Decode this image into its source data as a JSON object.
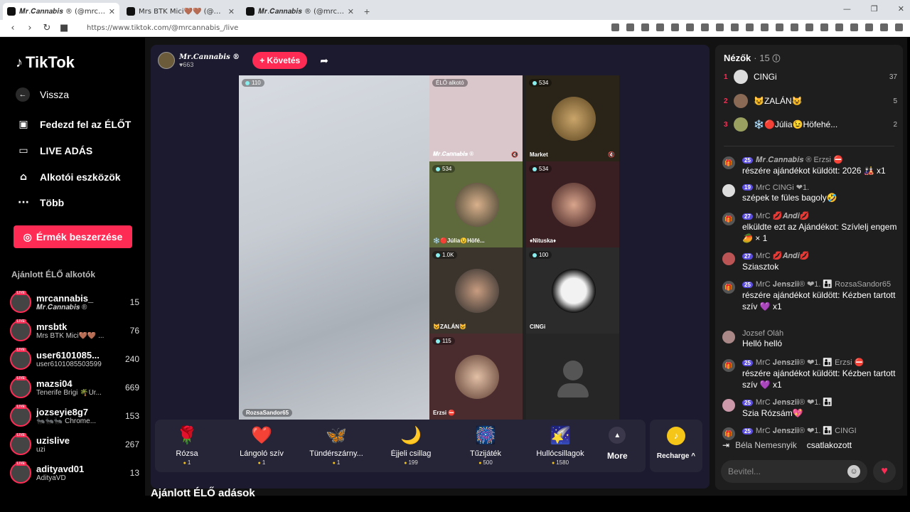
{
  "browser": {
    "tabs": [
      {
        "title": "𝑴𝒓.𝑪𝒂𝒏𝒏𝒂𝒃𝒊𝒔 ® (@mrcan",
        "active": true
      },
      {
        "title": "Mrs BTK Mici🤎🤎 (@mrsb",
        "active": false
      },
      {
        "title": "𝑴𝒓.𝑪𝒂𝒏𝒏𝒂𝒃𝒊𝒔 ® (@mrcannabis_)",
        "active": false
      }
    ],
    "url": "https://www.tiktok.com/@mrcannabis_/live"
  },
  "sidebar": {
    "logo": "TikTok",
    "back": "Vissza",
    "nav": [
      {
        "label": "Fedezd fel az ÉLŐT",
        "icon": "tv-icon"
      },
      {
        "label": "LIVE ADÁS",
        "icon": "camera-icon"
      },
      {
        "label": "Alkotói eszközök",
        "icon": "creator-tools-icon"
      },
      {
        "label": "Több",
        "icon": "more-icon"
      }
    ],
    "coins_button": "Érmék beszerzése",
    "recommended_title": "Ajánlott ÉLŐ alkotók",
    "creators": [
      {
        "name": "mrcannabis_",
        "sub": "𝑴𝒓.𝑪𝒂𝒏𝒏𝒂𝒃𝒊𝒔 ®",
        "count": "15"
      },
      {
        "name": "mrsbtk",
        "sub": "Mrs BTK Mici🤎🤎 ...",
        "count": "76"
      },
      {
        "name": "user6101085...",
        "sub": "user6101085503599",
        "count": "240"
      },
      {
        "name": "mazsi04",
        "sub": "Tenerife Brigi 🌴Úr...",
        "count": "669"
      },
      {
        "name": "jozseyie8g7",
        "sub": "🐜🐜🐜 Chrome...",
        "count": "153"
      },
      {
        "name": "uzislive",
        "sub": "uzi",
        "count": "267"
      },
      {
        "name": "adityavd01",
        "sub": "AdityaVD",
        "count": "13"
      }
    ]
  },
  "host": {
    "name": "𝑴𝒓.𝑪𝒂𝒏𝒏𝒂𝒃𝒊𝒔 ®",
    "likes": "♥663",
    "follow_label": "+ Követés"
  },
  "stage": {
    "main": {
      "badge": "110",
      "name": "RozsaSandor65"
    },
    "cells": [
      {
        "badge": "ÉLŐ alkotó",
        "name": "𝑴𝒓.𝑪𝒂𝒏𝒏𝒂𝒃𝒊𝒔 ®",
        "color": "#d9c7cc"
      },
      {
        "badge": "534",
        "name": "Market",
        "color": "#2a2418"
      },
      {
        "badge": "534",
        "name": "❄️🔴Júlia😉Höfé...",
        "color": "#5f6a3c"
      },
      {
        "badge": "534",
        "name": "♦Nituska♦",
        "color": "#3a1f22"
      },
      {
        "badge": "1.0K",
        "name": "😺ZALÁN😺",
        "color": "#3a342c"
      },
      {
        "badge": "100",
        "name": "CINGi",
        "color": "#2b2b2b"
      },
      {
        "badge": "115",
        "name": "Erzsi ⛔",
        "color": "#4a2c2e"
      },
      {
        "badge": "",
        "name": "",
        "color": "#262626"
      }
    ]
  },
  "gifts": [
    {
      "name": "Rózsa",
      "price": "1",
      "icon": "🌹"
    },
    {
      "name": "Lángoló szív",
      "price": "1",
      "icon": "❤️"
    },
    {
      "name": "Tündérszárny...",
      "price": "1",
      "icon": "🦋"
    },
    {
      "name": "Éjjeli csillag",
      "price": "199",
      "icon": "🌙"
    },
    {
      "name": "Tűzijáték",
      "price": "500",
      "icon": "🎆"
    },
    {
      "name": "Hullócsillagok",
      "price": "1580",
      "icon": "🌠"
    }
  ],
  "more_label": "More",
  "recharge_label": "Recharge ^",
  "recommended_lives": "Ajánlott ÉLŐ adások",
  "chat": {
    "viewers_title": "Nézők",
    "viewers_count": "· 15",
    "top_viewers": [
      {
        "rank": "1",
        "name": "CINGi",
        "score": "37"
      },
      {
        "rank": "2",
        "name": "😺ZALÁN😺",
        "score": "5"
      },
      {
        "rank": "3",
        "name": "❄️🔴Júlia😉Höfehé...",
        "score": "2"
      }
    ],
    "messages": [
      {
        "icon": "gift-icon",
        "lvl": "25",
        "tags": "𝑴𝒓.𝑪𝒂𝒏𝒏𝒂𝒃𝒊𝒔 ® Erzsi ⛔",
        "text": "részére ajándékot küldött: 2026 🎎 x1"
      },
      {
        "icon": "avatar",
        "lvl": "19",
        "tags": "MrC CINGi ❤1.",
        "text": "szépek te füles bagoly🤣"
      },
      {
        "icon": "gift-icon",
        "lvl": "27",
        "tags": "MrC 💋𝑨𝒏𝒅𝒊💋",
        "text": "elküldte ezt az Ajándékot: Szívlelj engem 🥭 × 1"
      },
      {
        "icon": "avatar",
        "lvl": "27",
        "tags": "MrC 💋𝑨𝒏𝒅𝒊💋",
        "text": "Sziasztok"
      },
      {
        "icon": "gift-icon",
        "lvl": "25",
        "tags": "MrC 𝐉𝐞𝐧𝐬𝐳𝐢𝐢® ❤1. 👨‍👦 RozsaSandor65",
        "text": "részére ajándékot küldött: Kézben tartott szív 💜 x1"
      },
      {
        "icon": "avatar",
        "lvl": "",
        "tags": "Jozsef Oláh",
        "text": "Helló helló"
      },
      {
        "icon": "gift-icon",
        "lvl": "25",
        "tags": "MrC 𝐉𝐞𝐧𝐬𝐳𝐢𝐢® ❤1. 👨‍👦 Erzsi ⛔",
        "text": "részére ajándékot küldött: Kézben tartott szív 💜 x1"
      },
      {
        "icon": "avatar",
        "lvl": "25",
        "tags": "MrC 𝐉𝐞𝐧𝐬𝐳𝐢𝐢® ❤1. 👨‍👦",
        "text": "Szia Rózsám💖"
      },
      {
        "icon": "gift-icon",
        "lvl": "25",
        "tags": "MrC 𝐉𝐞𝐧𝐬𝐳𝐢𝐢® ❤1. 👨‍👦 CINGI",
        "text": ""
      }
    ],
    "joined_name": "Béla Nemesnyik",
    "joined_text": "csatlakozott",
    "input_placeholder": "Bevitel..."
  }
}
